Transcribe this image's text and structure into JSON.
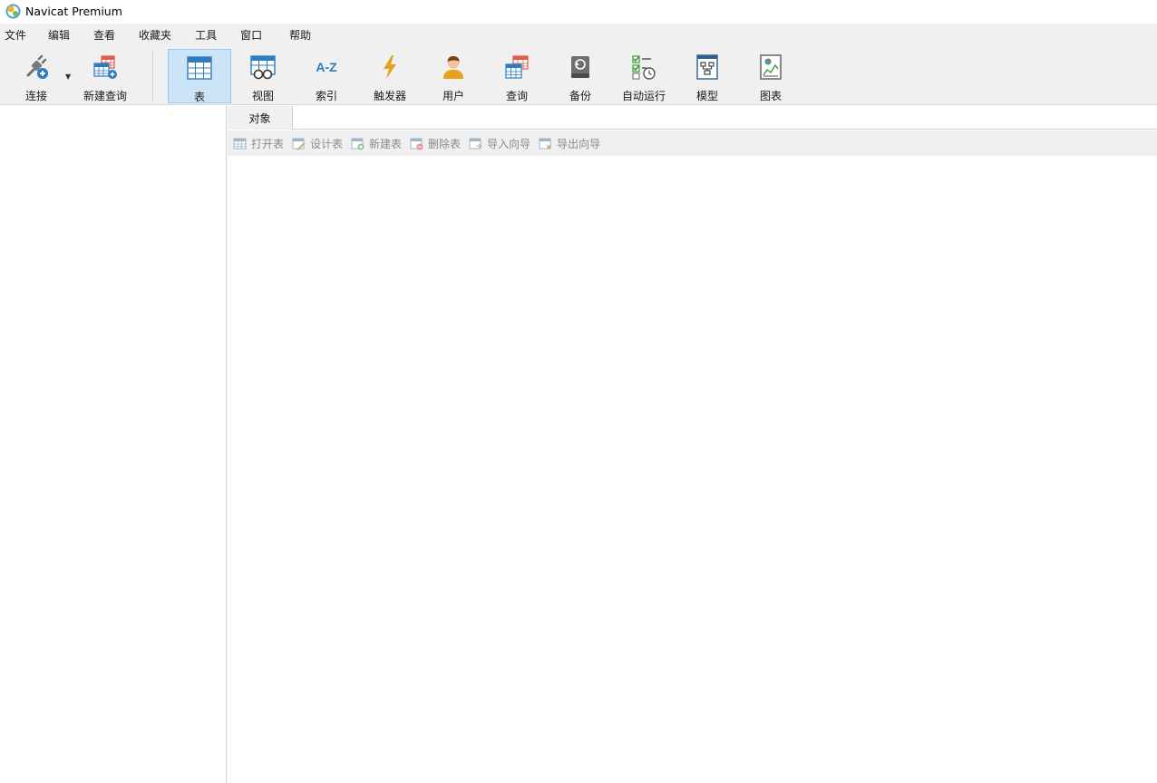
{
  "window": {
    "title": "Navicat Premium"
  },
  "menu": [
    "文件",
    "编辑",
    "查看",
    "收藏夹",
    "工具",
    "窗口",
    "帮助"
  ],
  "toolbar": {
    "connect": "连接",
    "new_query": "新建查询",
    "table": "表",
    "view": "视图",
    "index": "索引",
    "trigger": "触发器",
    "user": "用户",
    "query": "查询",
    "backup": "备份",
    "auto_run": "自动运行",
    "model": "模型",
    "chart": "图表",
    "index_icon_text": "A-Z"
  },
  "tabs": {
    "objects": "对象"
  },
  "object_toolbar": {
    "open_table": "打开表",
    "design_table": "设计表",
    "new_table": "新建表",
    "delete_table": "删除表",
    "import_wizard": "导入向导",
    "export_wizard": "导出向导"
  },
  "colors": {
    "active_bg": "#cce4f7",
    "accent_blue": "#2f7bbf",
    "accent_orange": "#e8a21a",
    "accent_red": "#e05a4f"
  }
}
